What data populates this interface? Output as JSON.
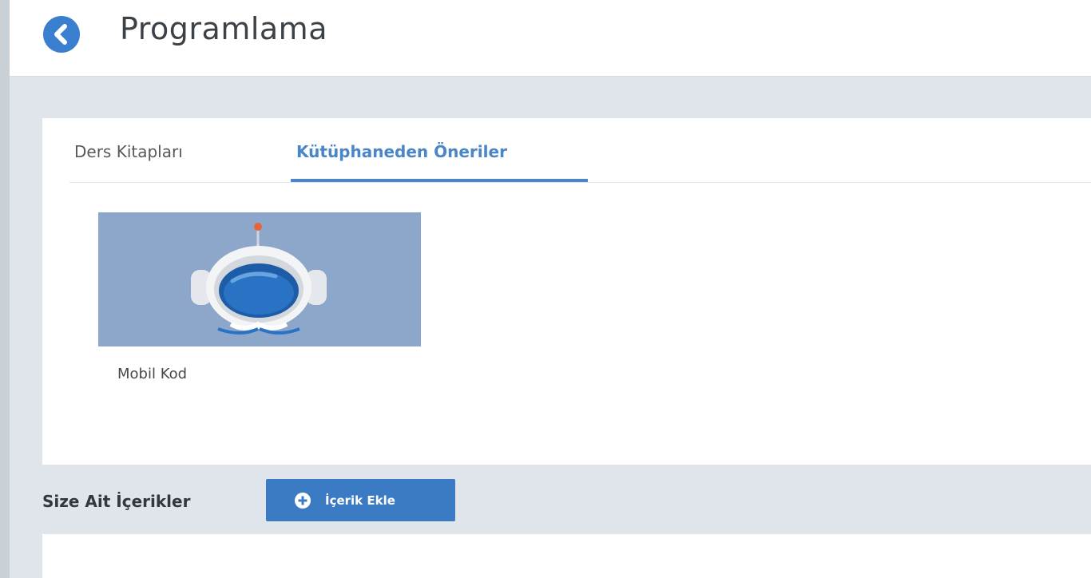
{
  "header": {
    "title": "Programlama",
    "back_icon": "chevron-left-icon"
  },
  "tabs": [
    {
      "label": "Ders Kitapları",
      "active": false
    },
    {
      "label": "Kütüphaneden Öneriler",
      "active": true
    }
  ],
  "books": [
    {
      "title": "Mobil Kod",
      "cover_icon": "astronaut-robot-icon"
    }
  ],
  "own_content": {
    "label": "Size Ait İçerikler",
    "add_button_label": "İçerik Ekle",
    "add_icon": "plus-circle-icon"
  },
  "colors": {
    "accent": "#3a7ed0",
    "tab_active": "#4a85c8",
    "background": "#dfe5ea",
    "cover_bg": "#8ca7c9"
  }
}
